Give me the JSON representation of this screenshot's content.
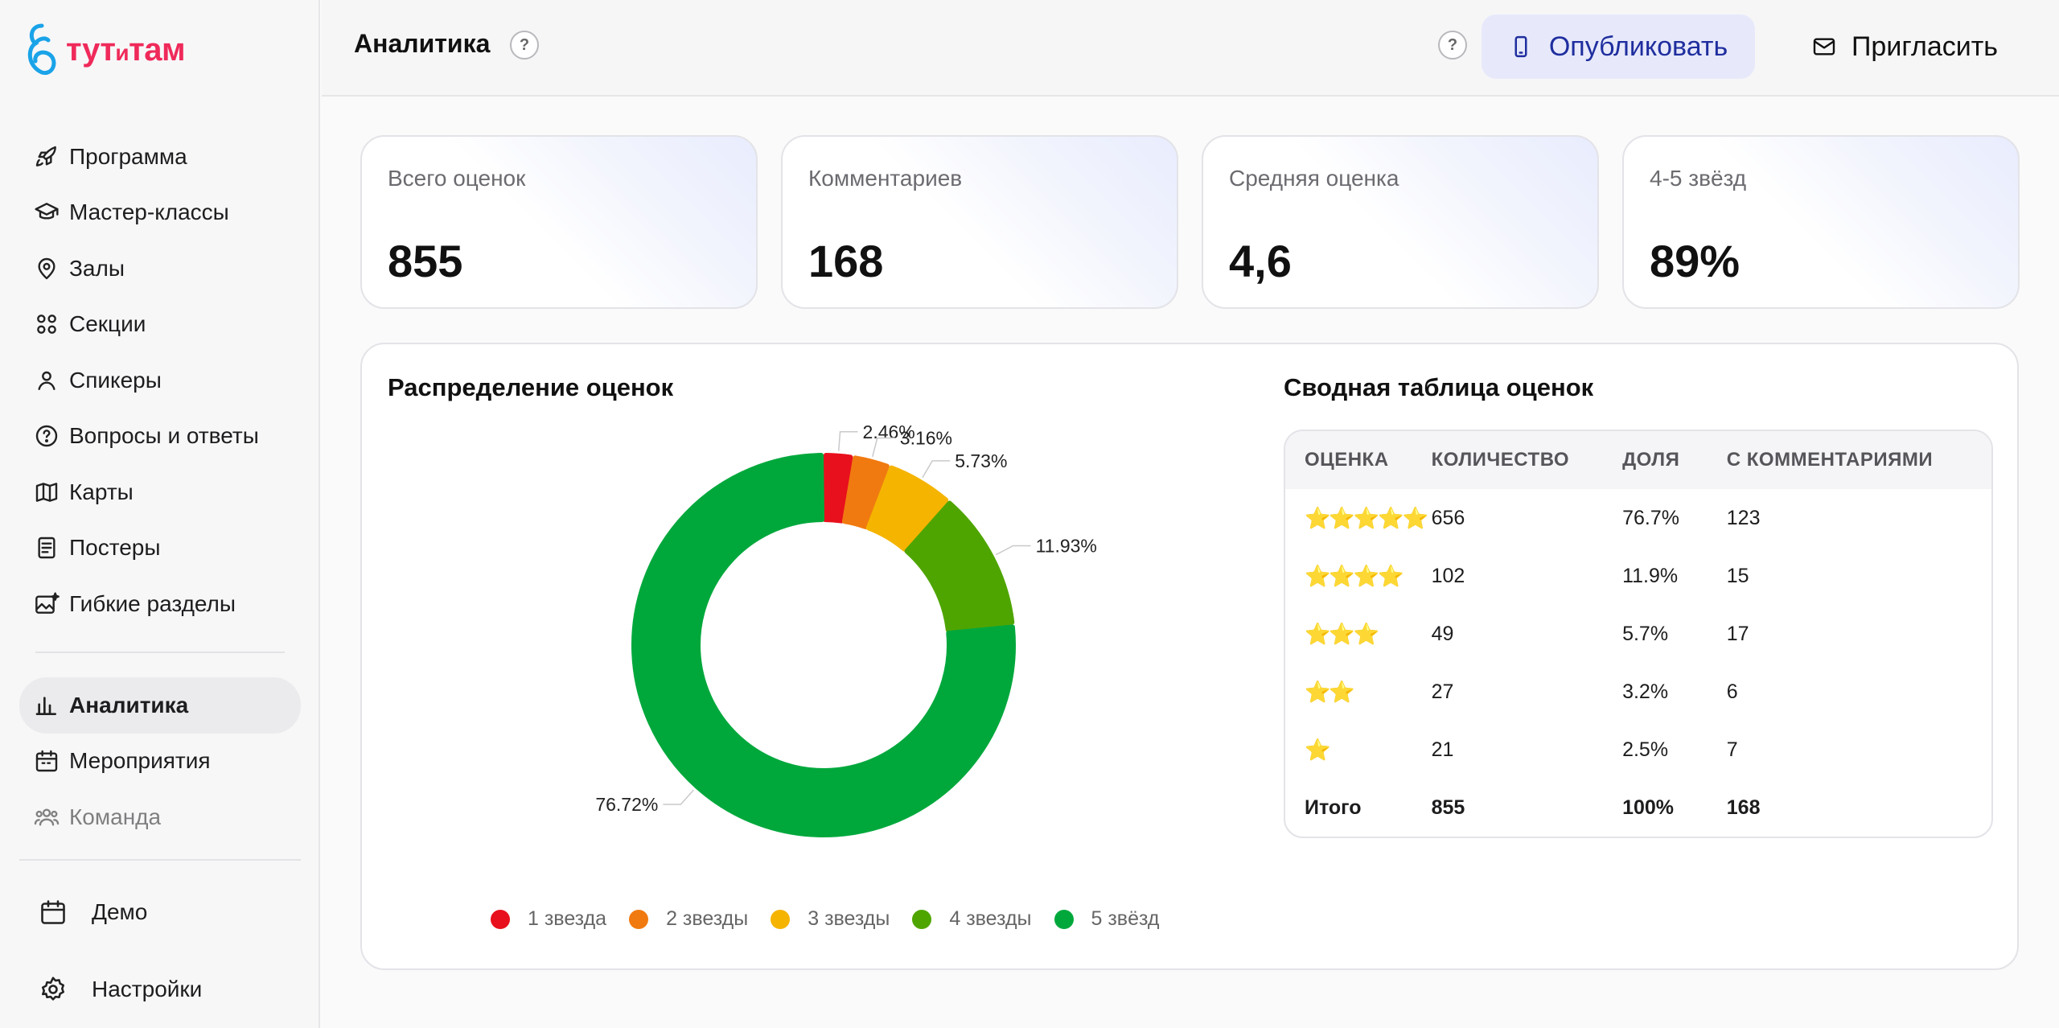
{
  "brand": {
    "name_a": "тут",
    "name_b": "и",
    "name_c": "там"
  },
  "sidebar": {
    "items": [
      {
        "label": "Программа",
        "icon": "rocket-icon"
      },
      {
        "label": "Мастер-классы",
        "icon": "graduation-cap-icon"
      },
      {
        "label": "Залы",
        "icon": "map-pin-icon"
      },
      {
        "label": "Секции",
        "icon": "grid-circles-icon"
      },
      {
        "label": "Спикеры",
        "icon": "person-icon"
      },
      {
        "label": "Вопросы и ответы",
        "icon": "question-circle-icon"
      },
      {
        "label": "Карты",
        "icon": "map-icon"
      },
      {
        "label": "Постеры",
        "icon": "poster-icon"
      },
      {
        "label": "Гибкие разделы",
        "icon": "image-sparkle-icon"
      }
    ],
    "items2": [
      {
        "label": "Аналитика",
        "icon": "bar-chart-icon",
        "active": true
      },
      {
        "label": "Мероприятия",
        "icon": "calendar-icon"
      },
      {
        "label": "Команда",
        "icon": "team-icon"
      }
    ],
    "bottom": [
      {
        "label": "Демо",
        "icon": "calendar-icon"
      },
      {
        "label": "Настройки",
        "icon": "gear-icon"
      }
    ]
  },
  "header": {
    "title": "Аналитика",
    "help": "?",
    "publish_label": "Опубликовать",
    "invite_label": "Пригласить"
  },
  "stats": [
    {
      "label": "Всего оценок",
      "value": "855"
    },
    {
      "label": "Комментариев",
      "value": "168"
    },
    {
      "label": "Средняя оценка",
      "value": "4,6"
    },
    {
      "label": "4-5 звёзд",
      "value": "89%"
    }
  ],
  "distribution": {
    "title": "Распределение оценок"
  },
  "chart_data": {
    "type": "pie",
    "donut": true,
    "categories": [
      "1 звезда",
      "2 звезды",
      "3 звезды",
      "4 звезды",
      "5 звёзд"
    ],
    "values": [
      2.46,
      3.16,
      5.73,
      11.93,
      76.72
    ],
    "data_labels": [
      "2.46%",
      "3.16%",
      "5.73%",
      "11.93%",
      "76.72%"
    ],
    "colors": [
      "#e8101c",
      "#f07a10",
      "#f5b400",
      "#4fa500",
      "#00a83c"
    ],
    "legend": "bottom"
  },
  "summary": {
    "title": "Сводная таблица оценок",
    "headers": [
      "ОЦЕНКА",
      "КОЛИЧЕСТВО",
      "ДОЛЯ",
      "С КОММЕНТАРИЯМИ"
    ],
    "rows": [
      {
        "stars": "⭐⭐⭐⭐⭐",
        "count": "656",
        "share": "76.7%",
        "comments": "123"
      },
      {
        "stars": "⭐⭐⭐⭐",
        "count": "102",
        "share": "11.9%",
        "comments": "15"
      },
      {
        "stars": "⭐⭐⭐",
        "count": "49",
        "share": "5.7%",
        "comments": "17"
      },
      {
        "stars": "⭐⭐",
        "count": "27",
        "share": "3.2%",
        "comments": "6"
      },
      {
        "stars": "⭐",
        "count": "21",
        "share": "2.5%",
        "comments": "7"
      }
    ],
    "total": {
      "label": "Итого",
      "count": "855",
      "share": "100%",
      "comments": "168"
    }
  }
}
